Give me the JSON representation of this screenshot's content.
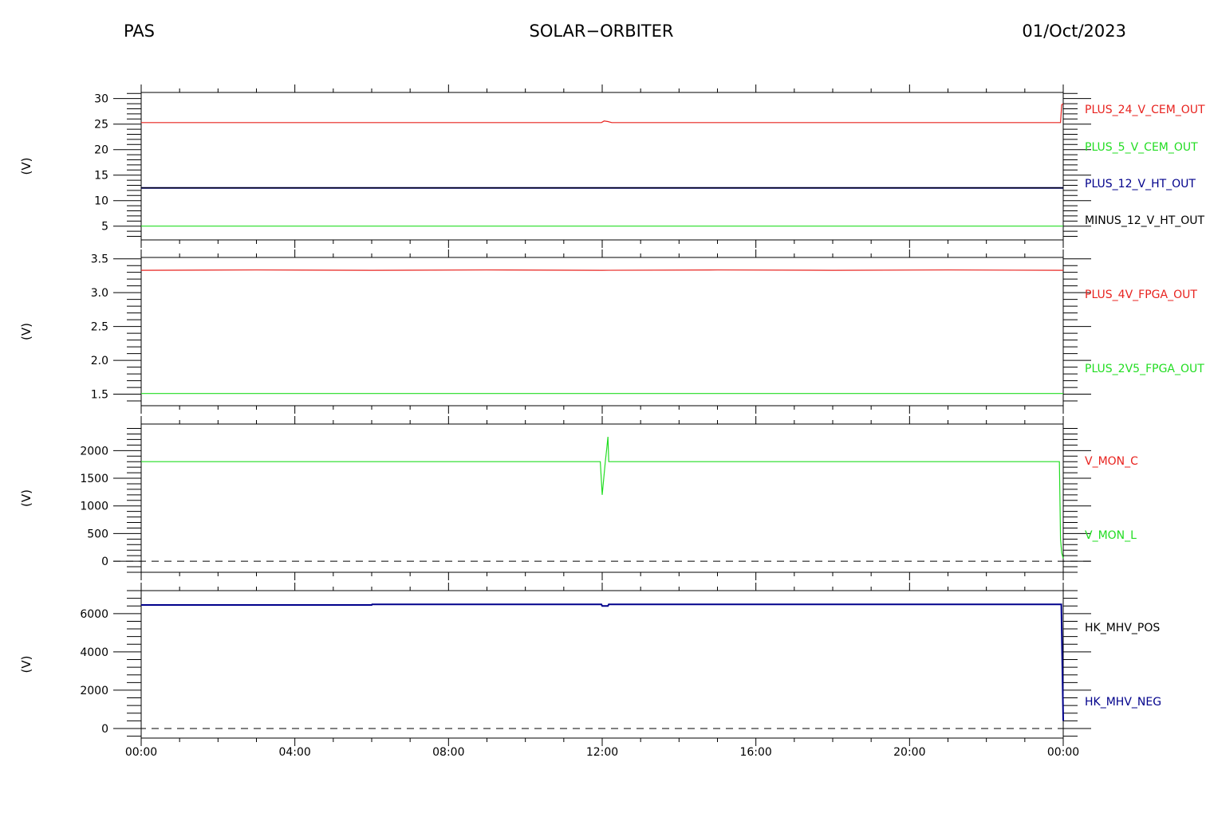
{
  "header": {
    "left": "PAS",
    "center": "SOLAR−ORBITER",
    "right": "01/Oct/2023"
  },
  "colors": {
    "red": "#e8231f",
    "green": "#22dd22",
    "blue": "#00008b",
    "black": "#000000"
  },
  "chart_data": [
    {
      "type": "line",
      "ylabel": "(V)",
      "ylim": [
        2.3,
        31.2
      ],
      "yticks": [
        "5",
        "10",
        "15",
        "20",
        "25",
        "30"
      ],
      "x": [
        "00:00",
        "04:00",
        "08:00",
        "12:00",
        "16:00",
        "20:00",
        "00:00"
      ],
      "series": [
        {
          "name": "PLUS_24_V_CEM_OUT",
          "color": "#e8231f",
          "points": [
            [
              0,
              25.3
            ],
            [
              11.98,
              25.3
            ],
            [
              12.05,
              25.6
            ],
            [
              12.15,
              25.5
            ],
            [
              12.25,
              25.3
            ],
            [
              23.93,
              25.3
            ],
            [
              23.96,
              28.8
            ],
            [
              24,
              29.0
            ]
          ]
        },
        {
          "name": "PLUS_5_V_CEM_OUT",
          "color": "#22dd22",
          "points": [
            [
              0,
              5.0
            ],
            [
              24,
              5.0
            ]
          ]
        },
        {
          "name": "PLUS_12_V_HT_OUT",
          "color": "#00008b",
          "points": [
            [
              0,
              12.5
            ],
            [
              24,
              12.5
            ]
          ]
        },
        {
          "name": "MINUS_12_V_HT_OUT",
          "color": "#000000",
          "points": [
            [
              0,
              12.5
            ],
            [
              24,
              12.5
            ]
          ]
        }
      ]
    },
    {
      "type": "line",
      "ylabel": "(V)",
      "ylim": [
        1.33,
        3.52
      ],
      "yticks": [
        "1.5",
        "2.0",
        "2.5",
        "3.0",
        "3.5"
      ],
      "x": [
        "00:00",
        "04:00",
        "08:00",
        "12:00",
        "16:00",
        "20:00",
        "00:00"
      ],
      "series": [
        {
          "name": "PLUS_4V_FPGA_OUT",
          "color": "#e8231f",
          "points": [
            [
              0,
              3.33
            ],
            [
              3,
              3.335
            ],
            [
              6,
              3.33
            ],
            [
              9,
              3.335
            ],
            [
              12,
              3.33
            ],
            [
              15,
              3.335
            ],
            [
              18,
              3.33
            ],
            [
              21,
              3.335
            ],
            [
              24,
              3.33
            ]
          ]
        },
        {
          "name": "PLUS_2V5_FPGA_OUT",
          "color": "#22dd22",
          "points": [
            [
              0,
              1.51
            ],
            [
              24,
              1.51
            ]
          ]
        }
      ]
    },
    {
      "type": "line",
      "ylabel": "(V)",
      "ylim": [
        -200,
        2480
      ],
      "yticks": [
        "0",
        "500",
        "1000",
        "1500",
        "2000"
      ],
      "x": [
        "00:00",
        "04:00",
        "08:00",
        "12:00",
        "16:00",
        "20:00",
        "00:00"
      ],
      "series": [
        {
          "name": "V_MON_C",
          "color": "#e8231f",
          "points": []
        },
        {
          "name": "V_MON_L",
          "color": "#22dd22",
          "points": [
            [
              0,
              1800
            ],
            [
              11.95,
              1800
            ],
            [
              12.0,
              1200
            ],
            [
              12.08,
              1800
            ],
            [
              12.12,
              2050
            ],
            [
              12.15,
              2250
            ],
            [
              12.17,
              1800
            ],
            [
              23.9,
              1800
            ],
            [
              23.93,
              400
            ],
            [
              23.96,
              150
            ],
            [
              24,
              50
            ]
          ]
        }
      ],
      "reference_line": 0
    },
    {
      "type": "line",
      "ylabel": "(V)",
      "ylim": [
        -500,
        7200
      ],
      "yticks": [
        "0",
        "2000",
        "4000",
        "6000"
      ],
      "x": [
        "00:00",
        "04:00",
        "08:00",
        "12:00",
        "16:00",
        "20:00",
        "00:00"
      ],
      "series": [
        {
          "name": "HK_MHV_POS",
          "color": "#000000",
          "points": []
        },
        {
          "name": "HK_MHV_NEG",
          "color": "#00008b",
          "points": [
            [
              0,
              6450
            ],
            [
              6,
              6450
            ],
            [
              6.01,
              6480
            ],
            [
              11.98,
              6480
            ],
            [
              12,
              6400
            ],
            [
              12.15,
              6400
            ],
            [
              12.17,
              6480
            ],
            [
              23.95,
              6480
            ],
            [
              23.98,
              3000
            ],
            [
              24,
              400
            ]
          ]
        }
      ],
      "reference_line": 0
    }
  ]
}
